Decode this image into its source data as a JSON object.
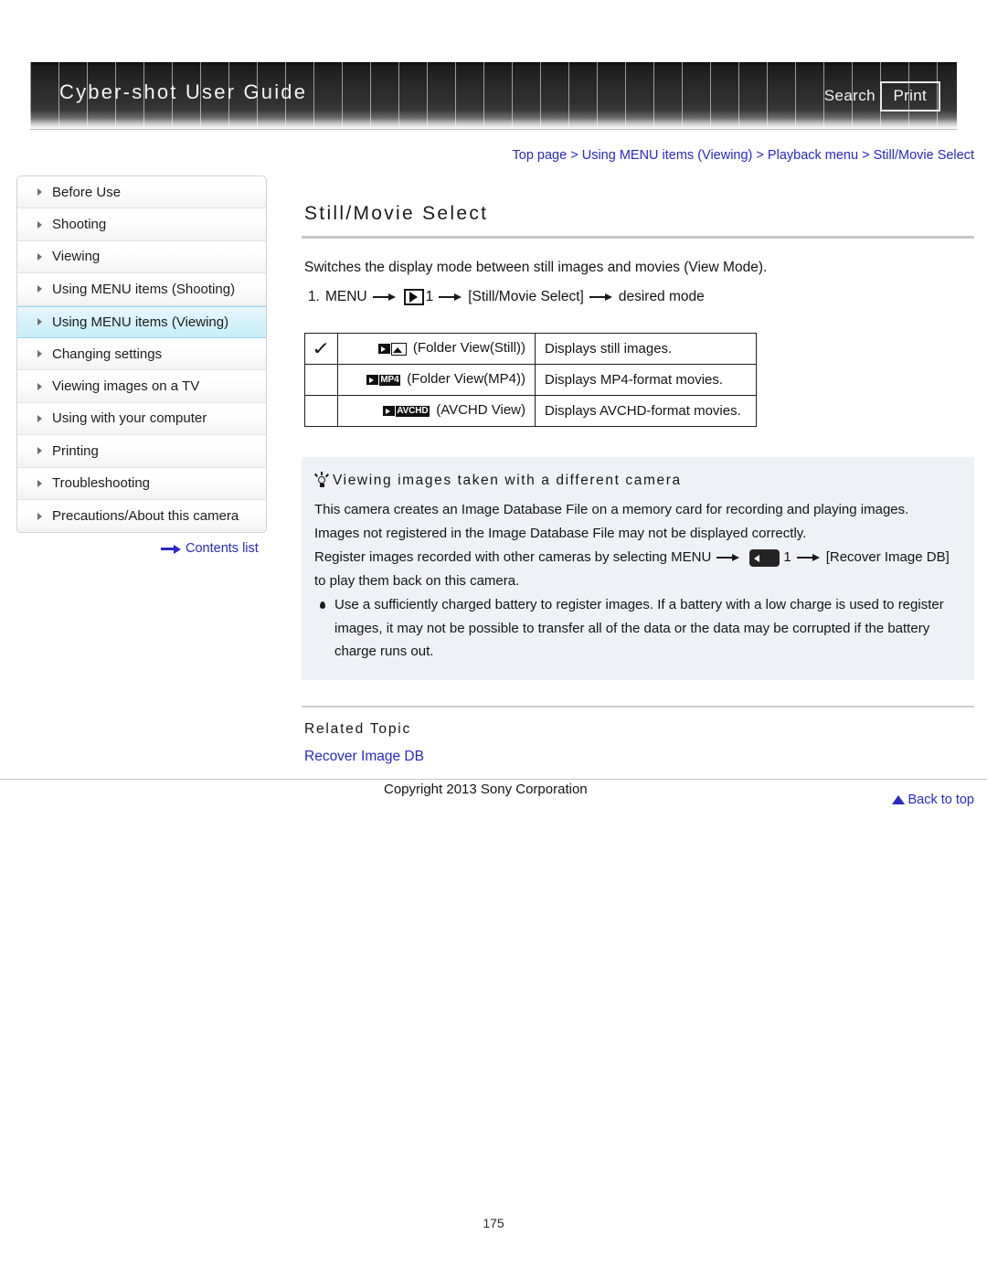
{
  "header": {
    "title": "Cyber-shot User Guide",
    "search_label": "Search",
    "print_label": "Print"
  },
  "breadcrumb": {
    "items": [
      "Top page",
      "Using MENU items (Viewing)",
      "Playback menu",
      "Still/Movie Select"
    ],
    "separator": ">"
  },
  "sidebar": {
    "items": [
      {
        "label": "Before Use",
        "active": false
      },
      {
        "label": "Shooting",
        "active": false
      },
      {
        "label": "Viewing",
        "active": false
      },
      {
        "label": "Using MENU items (Shooting)",
        "active": false
      },
      {
        "label": "Using MENU items (Viewing)",
        "active": true
      },
      {
        "label": "Changing settings",
        "active": false
      },
      {
        "label": "Viewing images on a TV",
        "active": false
      },
      {
        "label": "Using with your computer",
        "active": false
      },
      {
        "label": "Printing",
        "active": false
      },
      {
        "label": "Troubleshooting",
        "active": false
      },
      {
        "label": "Precautions/About this camera",
        "active": false
      }
    ],
    "contents_link": "Contents list"
  },
  "main": {
    "title": "Still/Movie Select",
    "intro": "Switches the display mode between still images and movies (View Mode).",
    "step": {
      "number": "1.",
      "menu_label": "MENU",
      "menu_icon": "playback-play-icon",
      "menu_index": "1",
      "bracket_item": "[Still/Movie Select]",
      "tail": "desired mode"
    },
    "options_table": {
      "rows": [
        {
          "checked": true,
          "icon": "folder-view-still-icon",
          "icon_text": "",
          "mode": "(Folder View(Still))",
          "description": "Displays still images."
        },
        {
          "checked": false,
          "icon": "folder-view-mp4-icon",
          "icon_text": "MP4",
          "mode": "(Folder View(MP4))",
          "description": "Displays MP4-format movies."
        },
        {
          "checked": false,
          "icon": "avchd-view-icon",
          "icon_text": "AVCHD",
          "mode": "(AVCHD View)",
          "description": "Displays AVCHD-format movies."
        }
      ]
    },
    "tip": {
      "icon": "lightbulb-icon",
      "heading": "Viewing images taken with a different camera",
      "line1": "This camera creates an Image Database File on a memory card for recording and playing images.",
      "line2": "Images not registered in the Image Database File may not be displayed correctly.",
      "line3_prefix": "Register images recorded with other cameras by selecting MENU",
      "line3_icon": "setup-menu-icon",
      "line3_index": "1",
      "line3_suffix": "[Recover Image DB]",
      "line4": "to play them back on this camera.",
      "bullets": [
        "Use a sufficiently charged battery to register images. If a battery with a low charge is used to register images, it may not be possible to transfer all of the data or the data may be corrupted if the battery charge runs out."
      ]
    },
    "related": {
      "heading": "Related Topic",
      "links": [
        "Recover Image DB"
      ]
    },
    "back_to_top": "Back to top"
  },
  "footer": {
    "copyright": "Copyright 2013 Sony Corporation",
    "page_number": "175"
  }
}
